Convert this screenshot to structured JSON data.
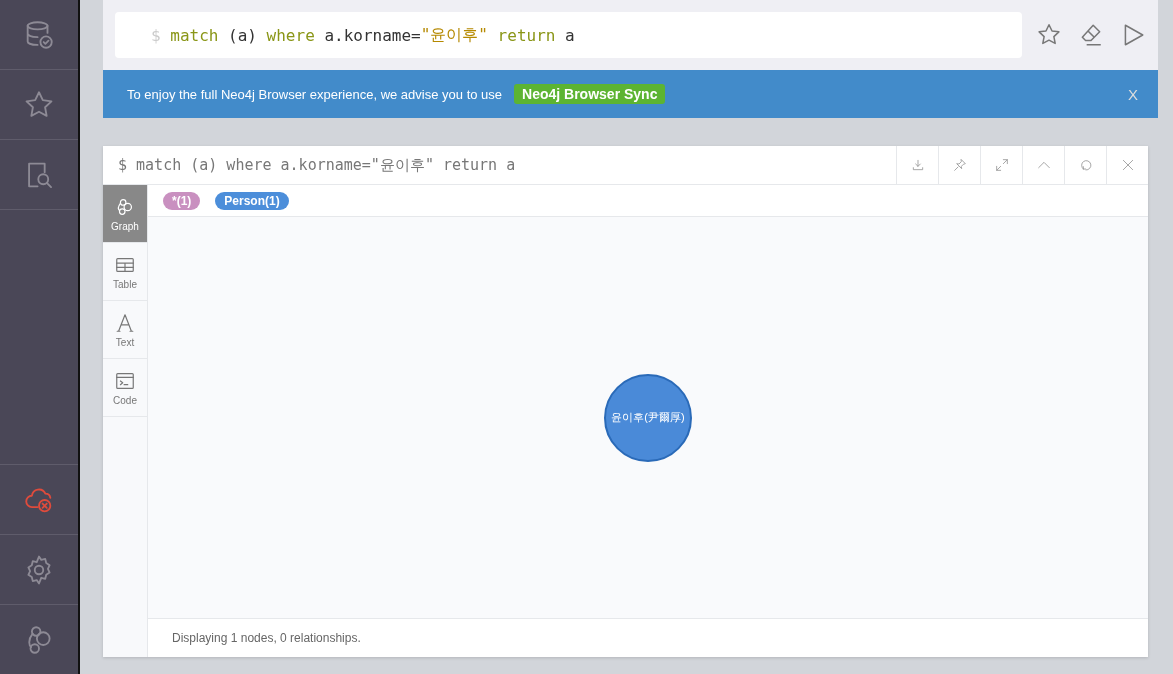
{
  "editor": {
    "prompt": "$",
    "tokens": [
      {
        "text": "match",
        "kind": "keyword",
        "space_before": true
      },
      {
        "text": "(a)",
        "kind": "plain",
        "space_before": true
      },
      {
        "text": "where",
        "kind": "keyword",
        "space_before": true
      },
      {
        "text": "a.korname=",
        "kind": "plain",
        "space_before": true
      },
      {
        "text": "\"윤이후\"",
        "kind": "string",
        "space_before": false
      },
      {
        "text": "return",
        "kind": "keyword",
        "space_before": true
      },
      {
        "text": "a",
        "kind": "plain",
        "space_before": true
      }
    ]
  },
  "banner": {
    "message": "To enjoy the full Neo4j Browser experience, we advise you to use",
    "link": "Neo4j Browser Sync",
    "close": "X"
  },
  "frame": {
    "title": "$ match (a) where a.korname=\"윤이후\" return a",
    "views": [
      {
        "label": "Graph",
        "kind": "graph",
        "selected": true
      },
      {
        "label": "Table",
        "kind": "table",
        "selected": false
      },
      {
        "label": "Text",
        "kind": "text",
        "selected": false
      },
      {
        "label": "Code",
        "kind": "code",
        "selected": false
      }
    ],
    "labels": [
      {
        "text": "*(1)",
        "color": "#c990c0"
      },
      {
        "text": "Person(1)",
        "color": "#4c8eda"
      }
    ],
    "node": {
      "label": "윤이후(尹爾厚)"
    },
    "status": "Displaying 1 nodes, 0 relationships."
  }
}
